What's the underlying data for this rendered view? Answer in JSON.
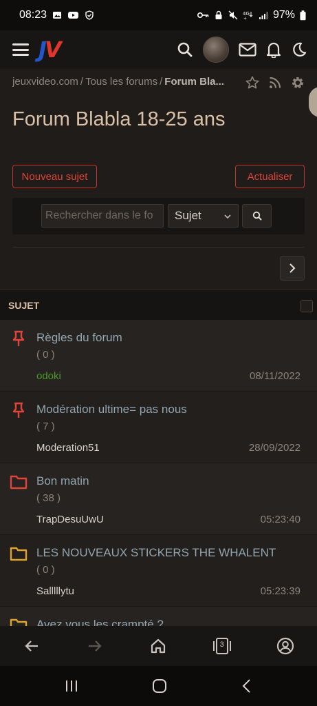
{
  "status_bar": {
    "time": "08:23",
    "battery": "97%"
  },
  "nav": {
    "logo_j": "J",
    "logo_v": "V"
  },
  "breadcrumb": {
    "items": [
      "jeuxvideo.com",
      "Tous les forums"
    ],
    "separator": "/",
    "current": "Forum Bla..."
  },
  "page_title": "Forum Blabla 18-25 ans",
  "actions": {
    "new_topic": "Nouveau sujet",
    "refresh": "Actualiser"
  },
  "search": {
    "placeholder": "Rechercher dans le fo",
    "select_value": "Sujet"
  },
  "list": {
    "header": "SUJET",
    "topics": [
      {
        "icon": "pin-icon",
        "title": "Règles du forum",
        "count": "( 0 )",
        "author": "odoki",
        "date": "08/11/2022"
      },
      {
        "icon": "pin-icon",
        "title": "Modération ultime= pas nous",
        "count": "( 7 )",
        "author": "Moderation51",
        "date": "28/09/2022"
      },
      {
        "icon": "folder-red-icon",
        "title": "Bon matin",
        "count": "( 38 )",
        "author": "TrapDesuUwU",
        "date": "05:23:40"
      },
      {
        "icon": "folder-yellow-icon",
        "title": "LES NOUVEAUX STICKERS THE WHALENT",
        "count": "( 0 )",
        "author": "Salllllytu",
        "date": "05:23:39"
      },
      {
        "icon": "folder-yellow-icon",
        "title": "Avez vous les crampté ?"
      }
    ]
  },
  "browser_bar": {
    "tabs_count": "3"
  },
  "colors": {
    "accent_red": "#e2443a",
    "title_beige": "#d9c0a6",
    "topic_title": "#93a6b0",
    "author_green": "#4a9a2c",
    "folder_yellow": "#e0a429"
  }
}
